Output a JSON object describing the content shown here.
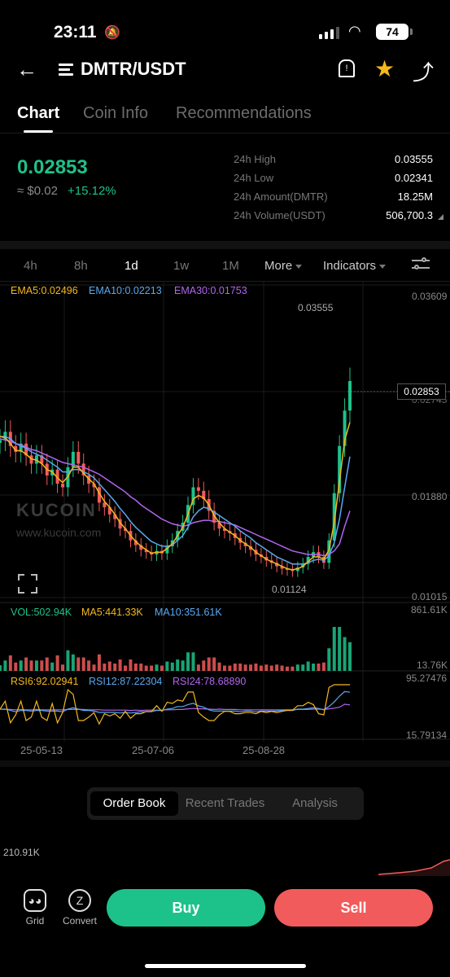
{
  "status": {
    "time": "23:11",
    "battery": "74"
  },
  "header": {
    "pair": "DMTR/USDT"
  },
  "tabs": [
    {
      "label": "Chart"
    },
    {
      "label": "Coin Info"
    },
    {
      "label": "Recommendations"
    }
  ],
  "price": {
    "last": "0.02853",
    "fiat": "≈ $0.02",
    "change": "+15.12%"
  },
  "stats": [
    {
      "k": "24h High",
      "v": "0.03555"
    },
    {
      "k": "24h Low",
      "v": "0.02341"
    },
    {
      "k": "24h Amount(DMTR)",
      "v": "18.25M"
    },
    {
      "k": "24h Volume(USDT)",
      "v": "506,700.3"
    }
  ],
  "intervals": [
    "4h",
    "8h",
    "1d",
    "1w",
    "1M"
  ],
  "more_label": "More",
  "indicators_label": "Indicators",
  "indicators": {
    "ema5": "EMA5:0.02496",
    "ema10": "EMA10:0.02213",
    "ema30": "EMA30:0.01753",
    "vol": "VOL:502.94K",
    "ma5": "MA5:441.33K",
    "ma10": "MA10:351.61K",
    "rsi6": "RSI6:92.02941",
    "rsi12": "RSI12:87.22304",
    "rsi24": "RSI24:78.68890"
  },
  "axis": {
    "p1": "0.03609",
    "p2": "0.02745",
    "p3": "0.01880",
    "p4": "0.01015",
    "v1": "861.61K",
    "v2": "13.76K",
    "r1": "95.27476",
    "r2": "15.79134",
    "high_mark": "0.03555",
    "low_mark": "0.01124",
    "current": "0.02853"
  },
  "dates": [
    "25-05-13",
    "25-07-06",
    "25-08-28"
  ],
  "watermark": {
    "brand": "KUCOIN",
    "url": "www.kucoin.com"
  },
  "bottom_tabs": [
    "Order Book",
    "Recent Trades",
    "Analysis"
  ],
  "depth_label": "210.91K",
  "actions": {
    "grid": "Grid",
    "convert": "Convert",
    "buy": "Buy",
    "sell": "Sell"
  },
  "colors": {
    "up": "#1DC28A",
    "down": "#F25B5B",
    "ema5": "#F4B81C",
    "ema10": "#5AA8F0",
    "ema30": "#B265F0"
  },
  "chart_data": {
    "type": "candlestick",
    "price_range": [
      0.01015,
      0.03609
    ],
    "closes": [
      0.0235,
      0.0242,
      0.023,
      0.0225,
      0.0232,
      0.0222,
      0.0215,
      0.0222,
      0.0215,
      0.0205,
      0.021,
      0.0198,
      0.0195,
      0.0212,
      0.0225,
      0.0215,
      0.0205,
      0.0198,
      0.0195,
      0.0182,
      0.0178,
      0.0172,
      0.0168,
      0.016,
      0.0158,
      0.015,
      0.0146,
      0.0142,
      0.014,
      0.0138,
      0.0141,
      0.0139,
      0.0145,
      0.015,
      0.0158,
      0.0165,
      0.018,
      0.0195,
      0.0192,
      0.0185,
      0.0175,
      0.0165,
      0.016,
      0.0158,
      0.0156,
      0.0152,
      0.0148,
      0.0145,
      0.0142,
      0.0138,
      0.0136,
      0.0133,
      0.0131,
      0.0128,
      0.0126,
      0.0125,
      0.0124,
      0.0127,
      0.013,
      0.0136,
      0.014,
      0.0136,
      0.0131,
      0.015,
      0.019,
      0.023,
      0.026,
      0.0285
    ],
    "ema5": [
      0.0238,
      0.0237,
      0.0232,
      0.0226,
      0.0226,
      0.0223,
      0.0219,
      0.0218,
      0.0215,
      0.021,
      0.0208,
      0.0203,
      0.0199,
      0.0204,
      0.0212,
      0.0212,
      0.0207,
      0.0202,
      0.0198,
      0.019,
      0.0183,
      0.0178,
      0.0172,
      0.0165,
      0.016,
      0.0154,
      0.0149,
      0.0145,
      0.0142,
      0.0139,
      0.014,
      0.014,
      0.0143,
      0.0147,
      0.0154,
      0.0161,
      0.0172,
      0.0185,
      0.0188,
      0.0186,
      0.018,
      0.0171,
      0.0165,
      0.016,
      0.0157,
      0.0154,
      0.015,
      0.0147,
      0.0144,
      0.014,
      0.0137,
      0.0134,
      0.0132,
      0.013,
      0.0128,
      0.0126,
      0.0125,
      0.0126,
      0.0128,
      0.0132,
      0.0136,
      0.0136,
      0.0134,
      0.0142,
      0.0165,
      0.02,
      0.0235,
      0.025
    ],
    "ema10": [
      0.0238,
      0.0238,
      0.0236,
      0.0232,
      0.023,
      0.0228,
      0.0225,
      0.0223,
      0.0221,
      0.0218,
      0.0215,
      0.0212,
      0.0208,
      0.0208,
      0.021,
      0.021,
      0.0208,
      0.0206,
      0.0203,
      0.0198,
      0.0193,
      0.0188,
      0.0183,
      0.0177,
      0.0172,
      0.0166,
      0.0161,
      0.0157,
      0.0153,
      0.0149,
      0.0147,
      0.0145,
      0.0145,
      0.0146,
      0.015,
      0.0154,
      0.0161,
      0.017,
      0.0175,
      0.0178,
      0.0177,
      0.0174,
      0.0171,
      0.0168,
      0.0165,
      0.0162,
      0.0158,
      0.0155,
      0.0152,
      0.0148,
      0.0145,
      0.0142,
      0.0139,
      0.0136,
      0.0134,
      0.0132,
      0.013,
      0.013,
      0.013,
      0.0131,
      0.0133,
      0.0134,
      0.0133,
      0.0137,
      0.0148,
      0.0168,
      0.0195,
      0.0221
    ],
    "ema30": [
      0.0236,
      0.0235,
      0.0234,
      0.0232,
      0.0231,
      0.0229,
      0.0227,
      0.0226,
      0.0224,
      0.0222,
      0.022,
      0.0218,
      0.0216,
      0.0215,
      0.0214,
      0.0213,
      0.0212,
      0.021,
      0.0208,
      0.0206,
      0.0203,
      0.02,
      0.0197,
      0.0194,
      0.0191,
      0.0187,
      0.0184,
      0.018,
      0.0177,
      0.0174,
      0.0171,
      0.0168,
      0.0166,
      0.0164,
      0.0163,
      0.0162,
      0.0163,
      0.0165,
      0.0166,
      0.0167,
      0.0167,
      0.0166,
      0.0166,
      0.0165,
      0.0164,
      0.0163,
      0.0161,
      0.0159,
      0.0157,
      0.0155,
      0.0153,
      0.0151,
      0.0149,
      0.0147,
      0.0145,
      0.0143,
      0.0141,
      0.014,
      0.0139,
      0.0138,
      0.0138,
      0.0138,
      0.0137,
      0.0138,
      0.0141,
      0.0147,
      0.0162,
      0.0175
    ]
  }
}
